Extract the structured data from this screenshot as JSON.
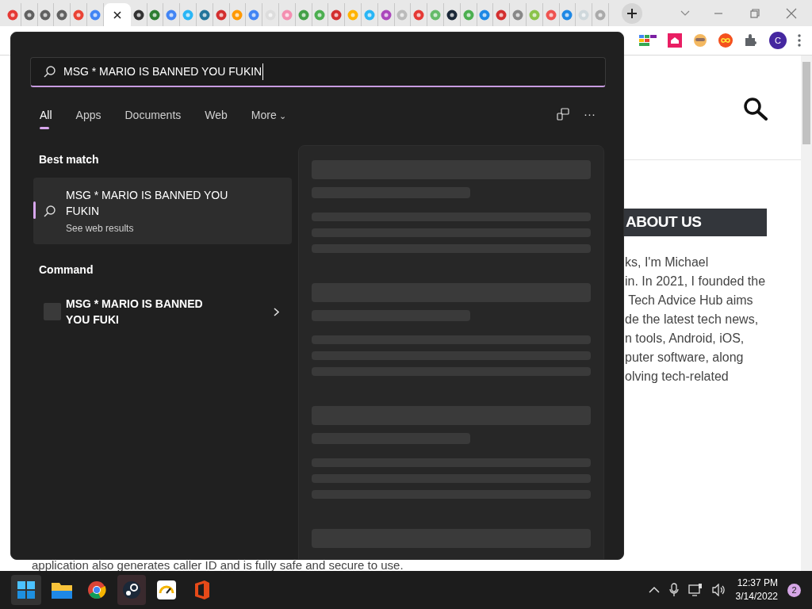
{
  "browser": {
    "tabs": [
      {
        "selected": false
      },
      {
        "selected": false
      },
      {
        "selected": false
      },
      {
        "selected": false
      },
      {
        "selected": false
      },
      {
        "selected": false
      },
      {
        "selected": true
      },
      {
        "selected": false
      },
      {
        "selected": false
      },
      {
        "selected": false
      },
      {
        "selected": false
      },
      {
        "selected": false
      },
      {
        "selected": false
      },
      {
        "selected": false
      },
      {
        "selected": false
      },
      {
        "selected": false
      },
      {
        "selected": false
      },
      {
        "selected": false
      },
      {
        "selected": false
      },
      {
        "selected": false
      },
      {
        "selected": false
      },
      {
        "selected": false
      },
      {
        "selected": false
      },
      {
        "selected": false
      },
      {
        "selected": false
      },
      {
        "selected": false
      },
      {
        "selected": false
      },
      {
        "selected": false
      },
      {
        "selected": false
      },
      {
        "selected": false
      },
      {
        "selected": false
      },
      {
        "selected": false
      },
      {
        "selected": false
      },
      {
        "selected": false
      },
      {
        "selected": false
      },
      {
        "selected": false
      }
    ],
    "profile_initial": "C"
  },
  "page": {
    "heading": "ABOUT US",
    "lines": [
      "ks, I'm Michael",
      "in. In 2021, I founded the",
      " Tech Advice Hub aims",
      "de the latest tech news,",
      "n tools, Android, iOS,",
      "puter software, along",
      "olving tech-related"
    ],
    "bottom_line": "application also generates caller ID and is fully safe and secure to use."
  },
  "search": {
    "query": "MSG * MARIO IS BANNED YOU FUKIN",
    "tabs": [
      {
        "label": "All",
        "selected": true
      },
      {
        "label": "Apps",
        "selected": false
      },
      {
        "label": "Documents",
        "selected": false
      },
      {
        "label": "Web",
        "selected": false
      },
      {
        "label": "More",
        "selected": false
      }
    ],
    "more_caret": "⌄",
    "more_menu": "···",
    "sections": [
      {
        "title": "Best match",
        "items": [
          {
            "kind": "web",
            "title": "MSG * MARIO IS BANNED YOU FUKIN",
            "subtitle": "See web results",
            "selected": true
          }
        ]
      },
      {
        "title": "Command",
        "items": [
          {
            "kind": "command",
            "title": "MSG * MARIO IS BANNED YOU FUKI",
            "selected": false
          }
        ]
      }
    ]
  },
  "taskbar": {
    "time": "12:37 PM",
    "date": "3/14/2022",
    "notifications": "2"
  }
}
